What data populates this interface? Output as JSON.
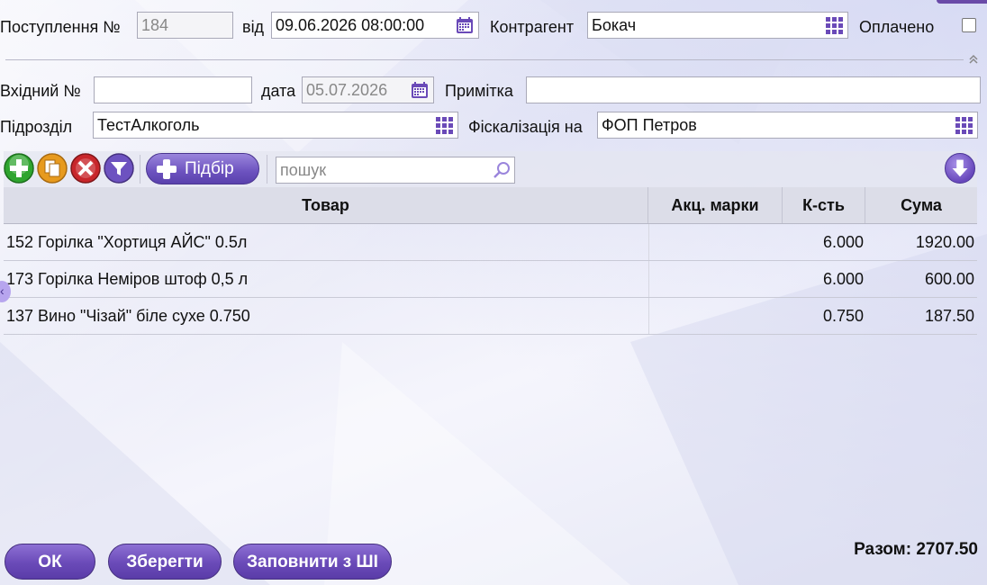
{
  "header": {
    "receipt_label": "Поступлення №",
    "receipt_number": "184",
    "from_label": "від",
    "date_value": "09.06.2026 08:00:00",
    "counterparty_label": "Контрагент",
    "counterparty_value": "Бокач",
    "paid_label": "Оплачено"
  },
  "details": {
    "incoming_label": "Вхідний №",
    "incoming_value": "",
    "date_label": "дата",
    "date_value": "05.07.2026",
    "note_label": "Примітка",
    "note_value": "",
    "division_label": "Підрозділ",
    "division_value": "ТестАлкоголь",
    "fiscal_label": "Фіскалізація на",
    "fiscal_value": "ФОП Петров"
  },
  "toolbar": {
    "pick_label": "Підбір",
    "search_placeholder": "пошук"
  },
  "table": {
    "columns": [
      "Товар",
      "Акц. марки",
      "К-сть",
      "Сума"
    ],
    "rows": [
      {
        "product": "152 Горілка \"Хортиця АЙС\" 0.5л",
        "excise": "",
        "qty": "6.000",
        "sum": "1920.00"
      },
      {
        "product": "173 Горілка Неміров штоф 0,5 л",
        "excise": "",
        "qty": "6.000",
        "sum": "600.00"
      },
      {
        "product": "137 Вино \"Чізай\" біле сухе 0.750",
        "excise": "",
        "qty": "0.750",
        "sum": "187.50"
      }
    ]
  },
  "footer": {
    "ok_label": "ОК",
    "save_label": "Зберегти",
    "fill_label": "Заповнити з ШІ",
    "total_label": "Разом: 2707.50"
  },
  "colors": {
    "accent": "#6a4ab8",
    "add_green": "#2fa52f",
    "copy_orange": "#e79a1e",
    "delete_red": "#c8262b",
    "filter_purple": "#6d52c0"
  },
  "icons": [
    "calendar-icon",
    "grid-picker-icon",
    "collapse-icon",
    "add-icon",
    "copy-icon",
    "delete-icon",
    "filter-icon",
    "search-icon",
    "download-icon"
  ]
}
